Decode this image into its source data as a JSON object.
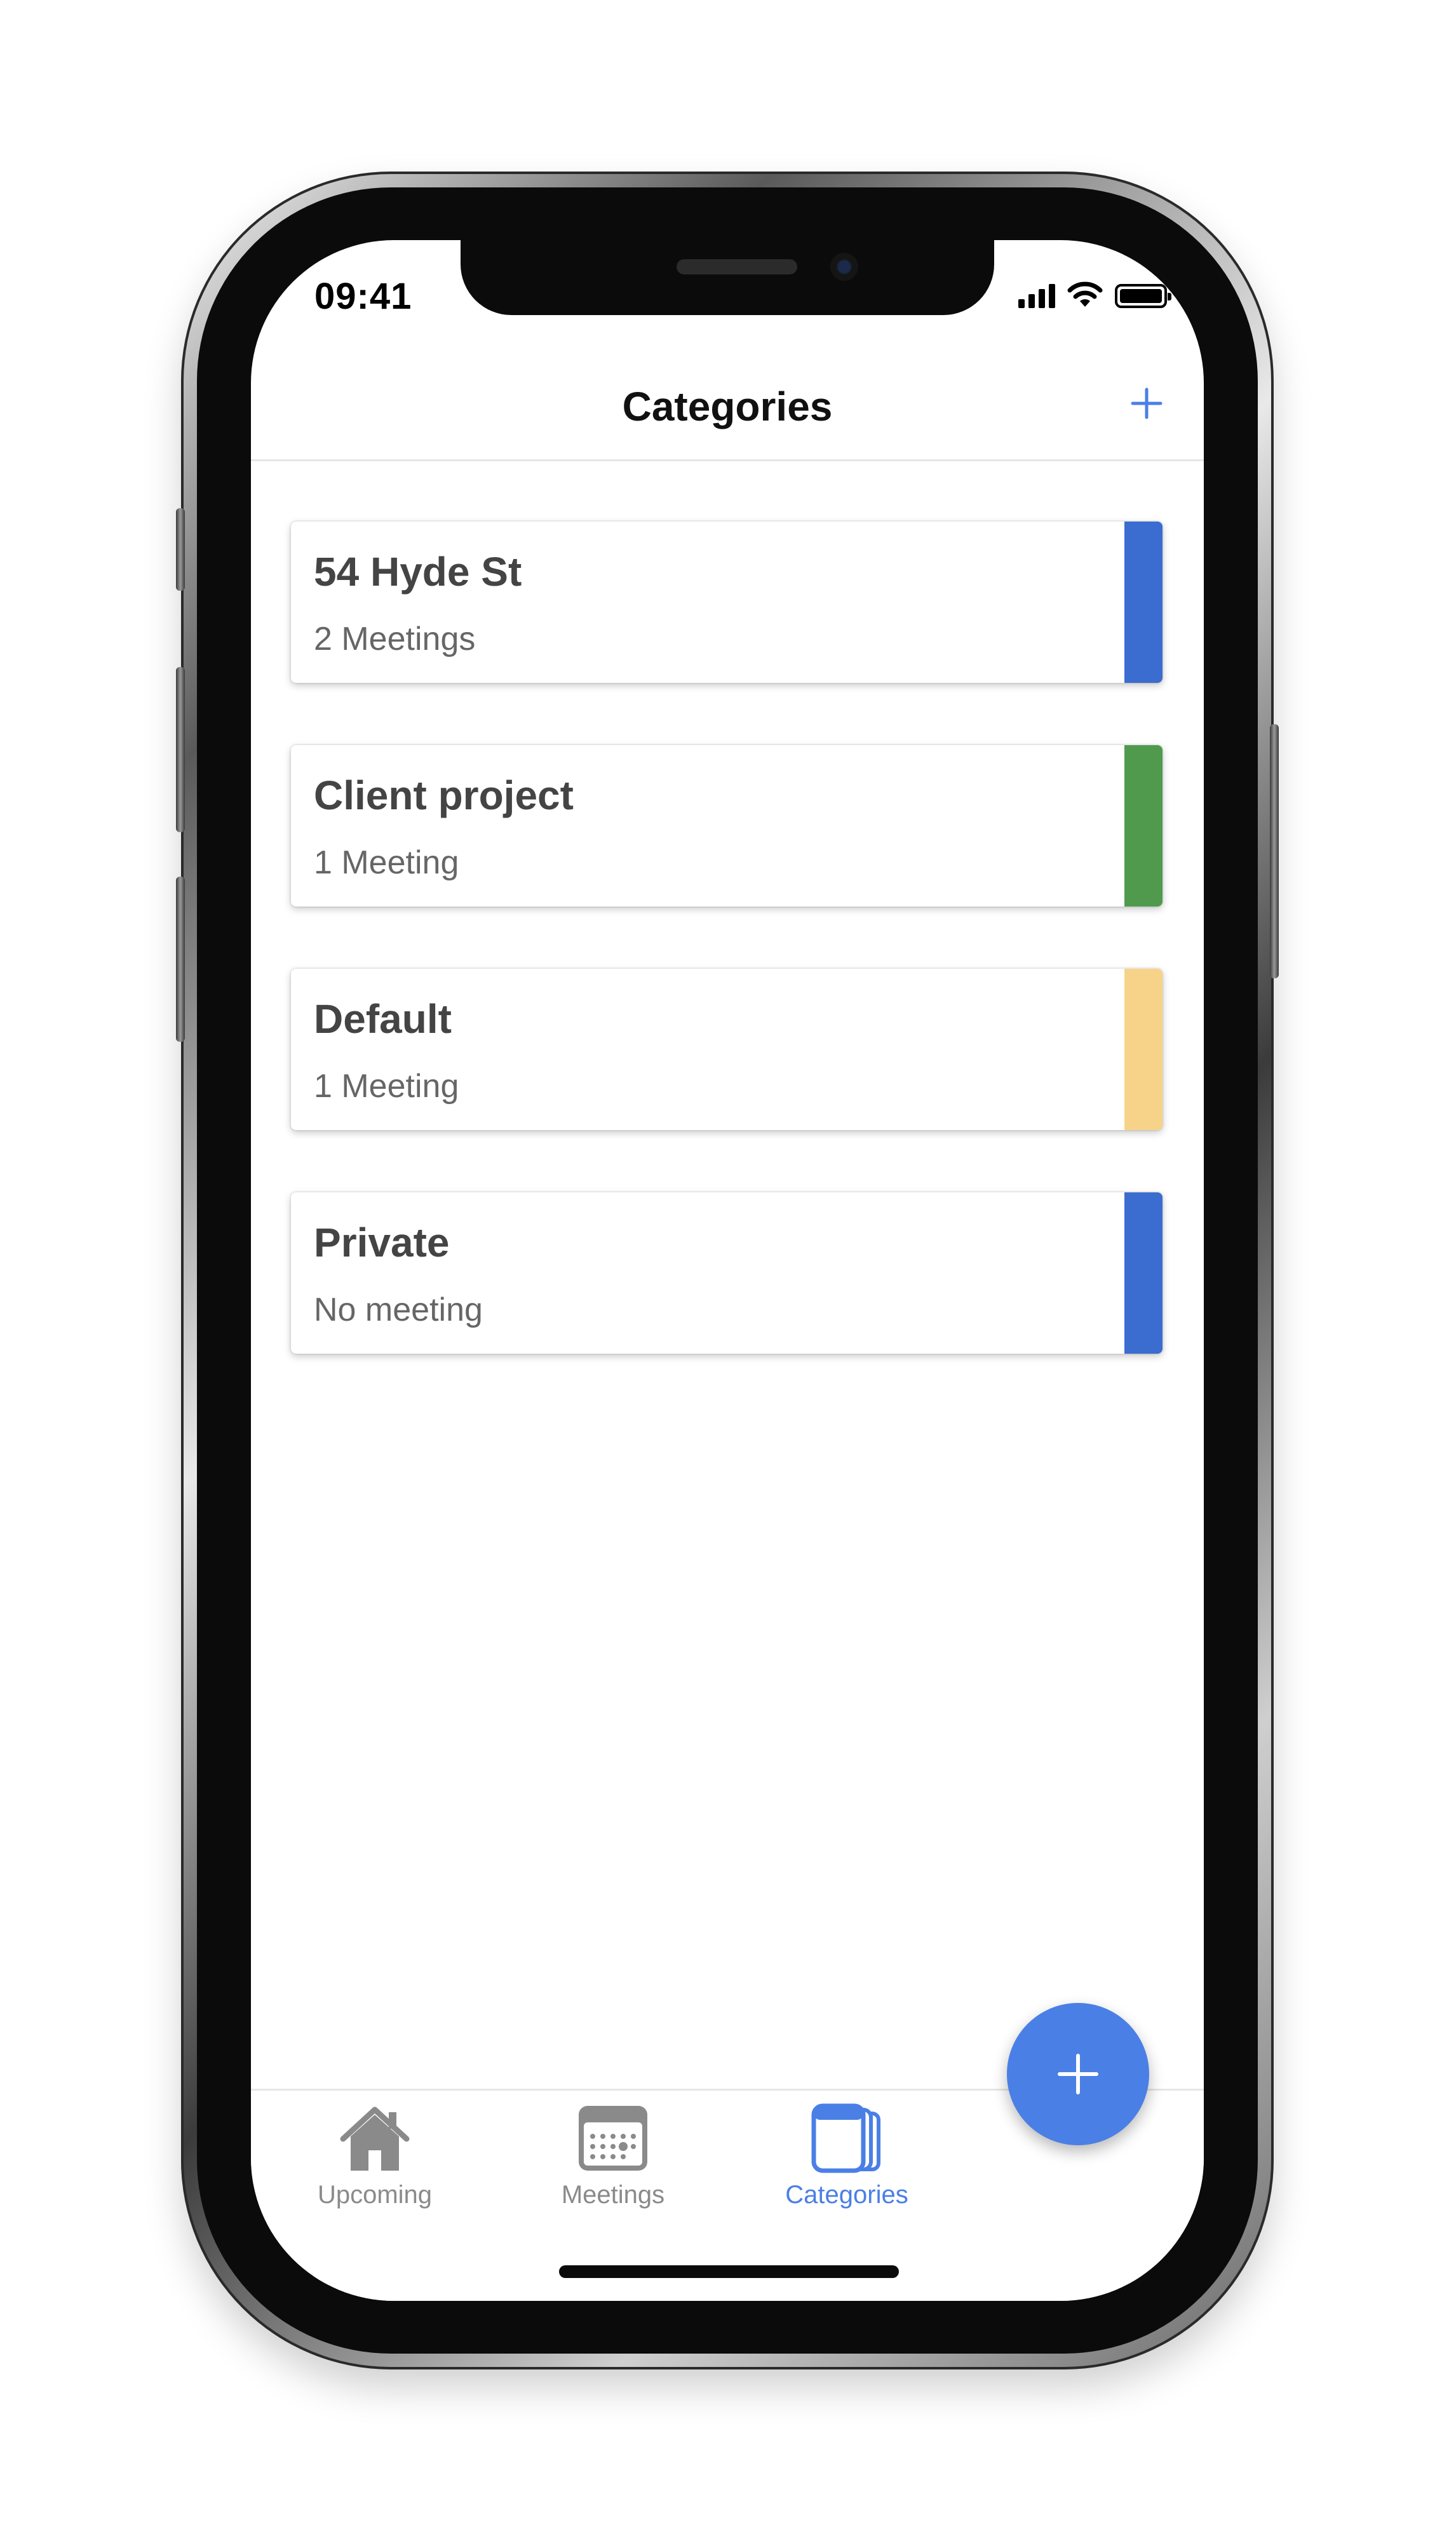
{
  "status_bar": {
    "time": "09:41"
  },
  "header": {
    "title": "Categories"
  },
  "categories": [
    {
      "title": "54 Hyde St",
      "subtitle": "2 Meetings",
      "color": "#3b6ccf"
    },
    {
      "title": "Client project",
      "subtitle": "1 Meeting",
      "color": "#4f9a4c"
    },
    {
      "title": "Default",
      "subtitle": "1 Meeting",
      "color": "#f7d38a"
    },
    {
      "title": "Private",
      "subtitle": "No meeting",
      "color": "#3b6ccf"
    }
  ],
  "tabs": [
    {
      "label": "Upcoming",
      "icon": "house-icon",
      "active": false
    },
    {
      "label": "Meetings",
      "icon": "calendar-icon",
      "active": false
    },
    {
      "label": "Categories",
      "icon": "stacked-cards-icon",
      "active": true
    }
  ],
  "colors": {
    "accent": "#4a7fe6",
    "inactive": "#8a8a8a"
  }
}
